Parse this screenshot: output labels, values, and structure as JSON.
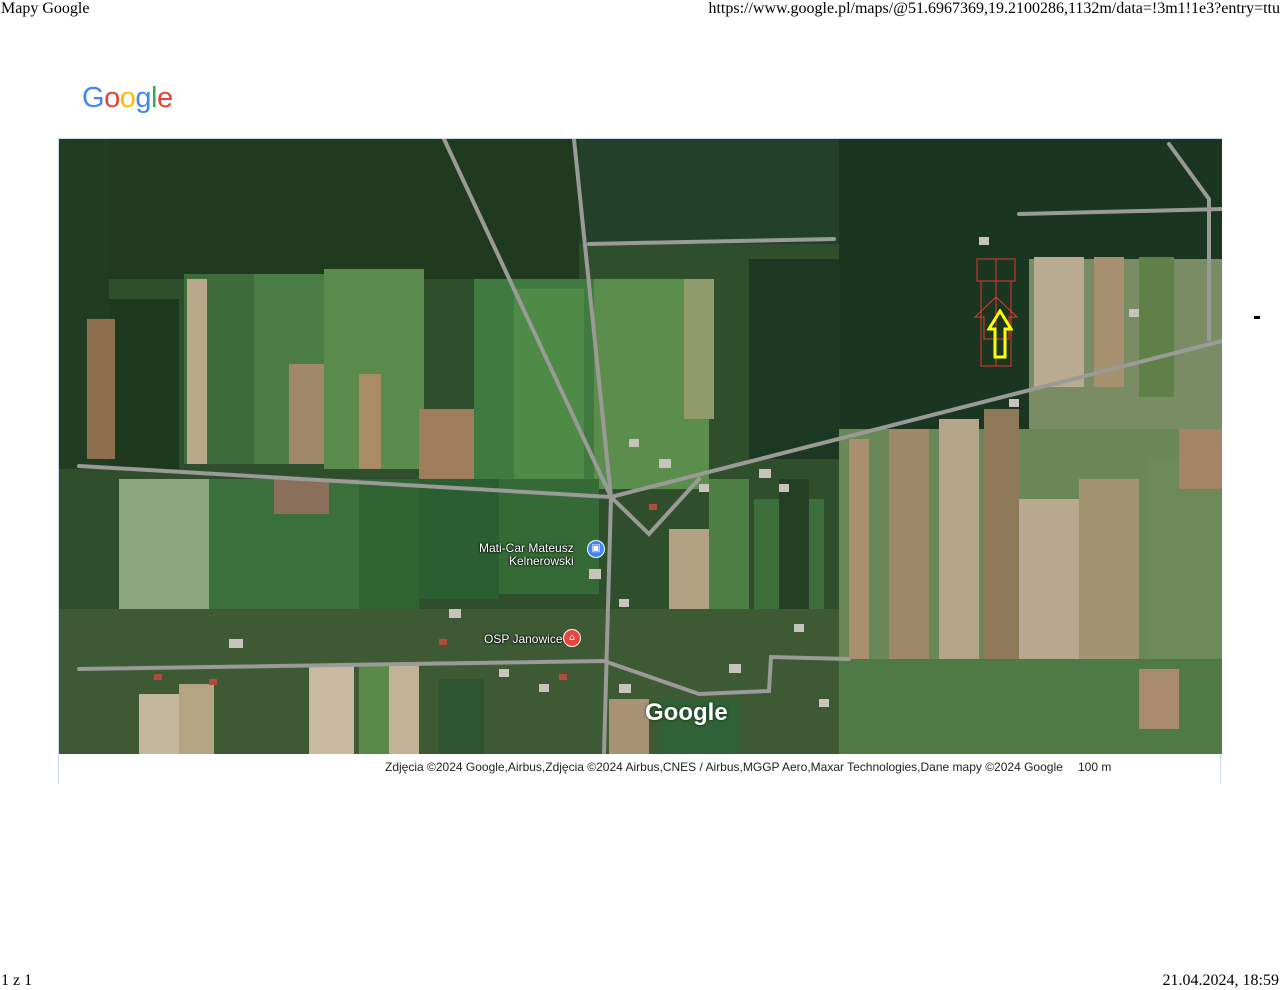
{
  "header": {
    "title": "Mapy Google",
    "url": "https://www.google.pl/maps/@51.6967369,19.2100286,1132m/data=!3m1!1e3?entry=ttu"
  },
  "logo": {
    "letters": [
      "G",
      "o",
      "o",
      "g",
      "l",
      "e"
    ],
    "colors": [
      "#4285F4",
      "#EA4335",
      "#FBBC05",
      "#4285F4",
      "#34A853",
      "#EA4335"
    ]
  },
  "map": {
    "type": "satellite",
    "watermark": "Google",
    "pois": [
      {
        "name_line1": "Mati-Car Mateusz",
        "name_line2": "Kelnerowski",
        "icon": "shopping-bag-icon",
        "color": "#4285F4"
      },
      {
        "name_line1": "OSP Janowice",
        "name_line2": "",
        "icon": "fire-station-icon",
        "color": "#E8453C"
      }
    ],
    "marker": {
      "icon": "arrow-up-icon",
      "color": "#FFFF00",
      "parcel_color": "#E53935"
    },
    "attribution": "Zdjęcia ©2024 Google,Airbus,Zdjęcia ©2024 Airbus,CNES / Airbus,MGGP Aero,Maxar Technologies,Dane mapy ©2024 Google",
    "scale_label": "100 m"
  },
  "footer": {
    "page": "1 z 1",
    "datetime": "21.04.2024, 18:59"
  }
}
